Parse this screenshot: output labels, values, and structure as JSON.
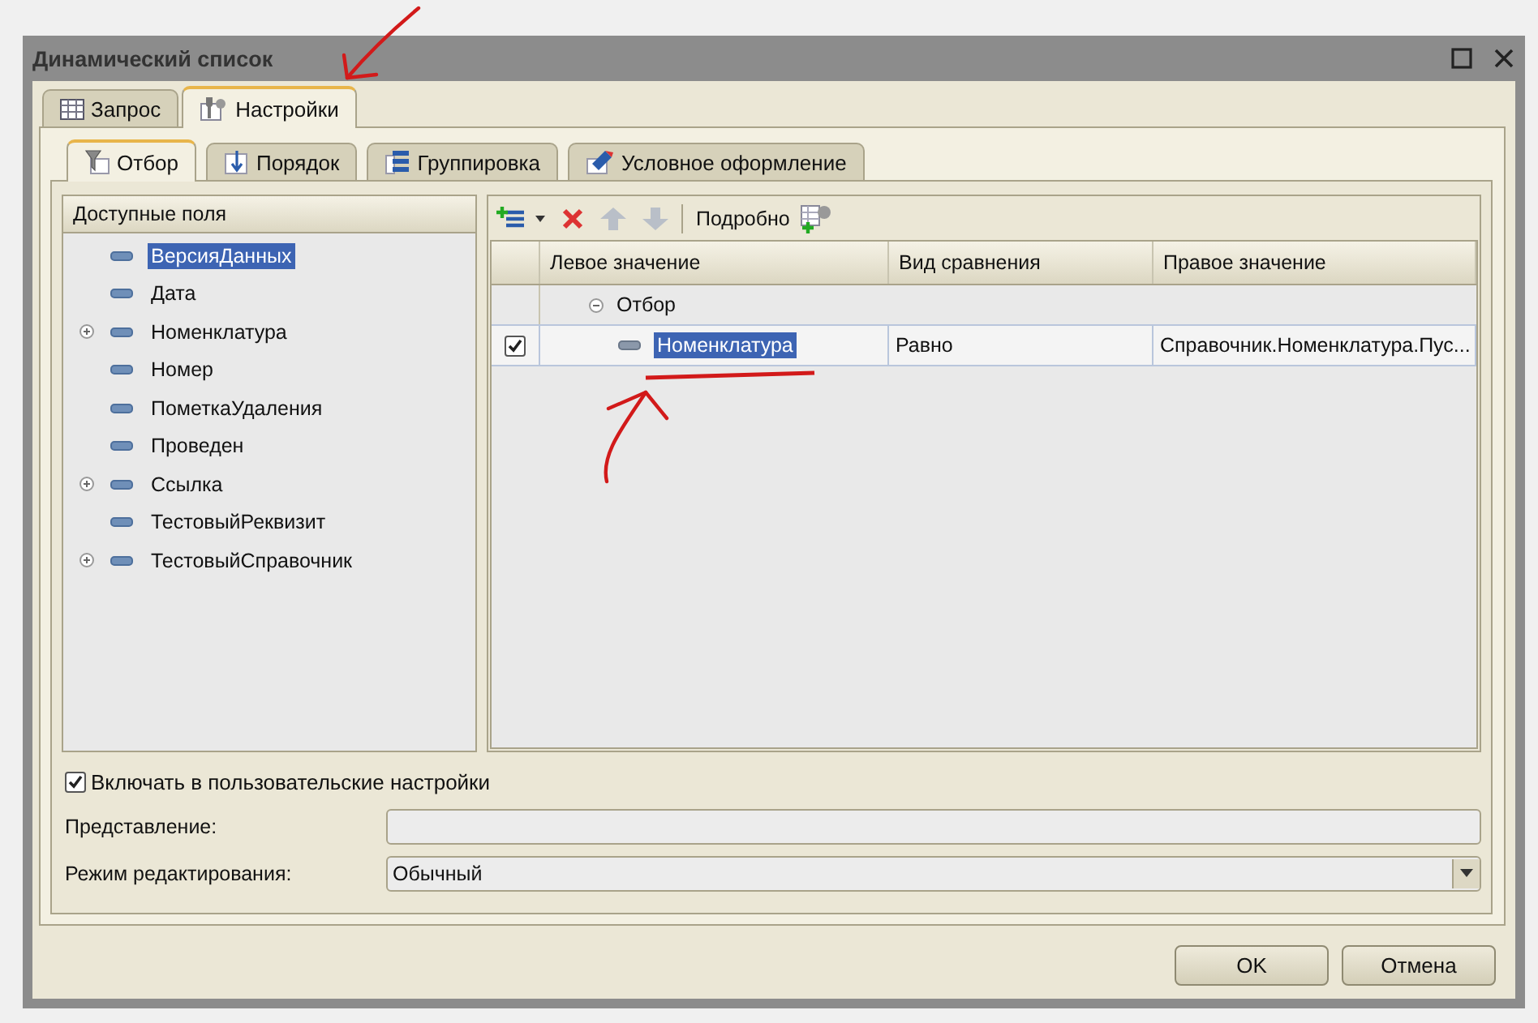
{
  "window": {
    "title": "Динамический список"
  },
  "tabs": [
    {
      "label": "Запрос",
      "selected": false
    },
    {
      "label": "Настройки",
      "selected": true
    }
  ],
  "subtabs": [
    {
      "label": "Отбор",
      "selected": true
    },
    {
      "label": "Порядок",
      "selected": false
    },
    {
      "label": "Группировка",
      "selected": false
    },
    {
      "label": "Условное оформление",
      "selected": false
    }
  ],
  "fields": {
    "header": "Доступные поля",
    "items": [
      {
        "label": "ВерсияДанных",
        "selected": true,
        "has_children": false
      },
      {
        "label": "Дата",
        "selected": false,
        "has_children": false
      },
      {
        "label": "Номенклатура",
        "selected": false,
        "has_children": true
      },
      {
        "label": "Номер",
        "selected": false,
        "has_children": false
      },
      {
        "label": "ПометкаУдаления",
        "selected": false,
        "has_children": false
      },
      {
        "label": "Проведен",
        "selected": false,
        "has_children": false
      },
      {
        "label": "Ссылка",
        "selected": false,
        "has_children": true
      },
      {
        "label": "ТестовыйРеквизит",
        "selected": false,
        "has_children": false
      },
      {
        "label": "ТестовыйСправочник",
        "selected": false,
        "has_children": true
      }
    ]
  },
  "filter": {
    "details_label": "Подробно",
    "columns": [
      "Левое значение",
      "Вид сравнения",
      "Правое значение"
    ],
    "rows": [
      {
        "label": "Отбор",
        "expanded": true,
        "children": [
          {
            "checked": true,
            "left": "Номенклатура",
            "selected": true,
            "comparison": "Равно",
            "right": "Справочник.Номенклатура.Пус..."
          }
        ]
      }
    ]
  },
  "include_option": {
    "label": "Включать в пользовательские настройки",
    "checked": true
  },
  "form_fields": [
    {
      "kind": "text",
      "label": "Представление:"
    },
    {
      "kind": "dropdown",
      "label": "Режим редактирования:",
      "value": "Обычный"
    }
  ],
  "buttons": [
    "OK",
    "Отмена"
  ]
}
